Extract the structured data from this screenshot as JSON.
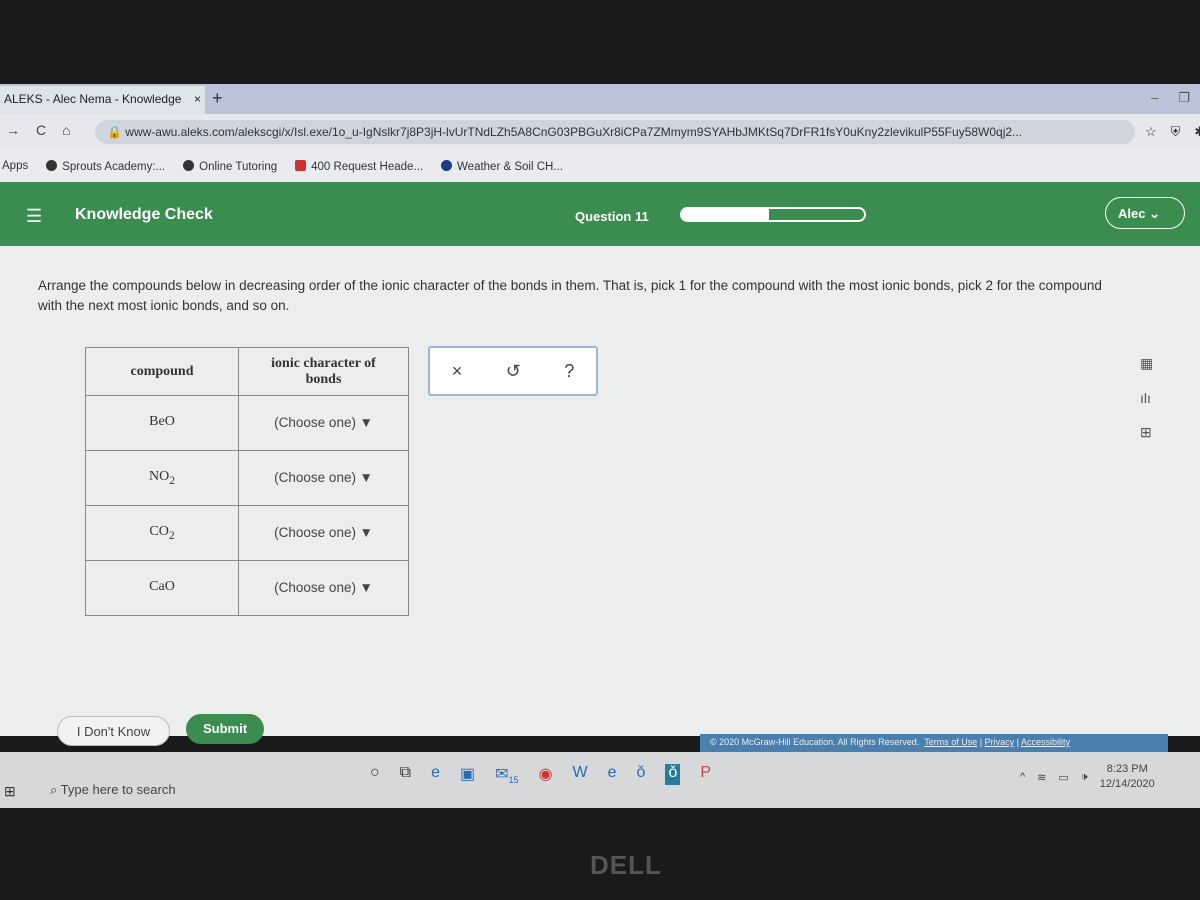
{
  "browser": {
    "tab_title": "ALEKS - Alec Nema - Knowledge",
    "tab_close": "×",
    "new_tab": "+",
    "url": "www-awu.aleks.com/alekscgi/x/Isl.exe/1o_u-IgNslkr7j8P3jH-lvUrTNdLZh5A8CnG03PBGuXr8iCPa7ZMmym9SYAHbJMKtSq7DrFR1fsY0uKny2zlevikulP55Fuy58W0qj2...",
    "bookmarks": [
      "Apps",
      "Sprouts Academy:...",
      "Online Tutoring",
      "400 Request Heade...",
      "Weather & Soil CH..."
    ]
  },
  "header": {
    "title": "Knowledge Check",
    "question": "Question 11",
    "progress": 0.48,
    "user": "Alec",
    "accent": "#3a8d4f"
  },
  "prompt": "Arrange the compounds below in decreasing order of the ionic character of the bonds in them. That is, pick 1 for the compound with the most ionic bonds, pick 2 for the compound with the next most ionic bonds, and so on.",
  "table": {
    "headers": [
      "compound",
      "ionic character of bonds"
    ],
    "rows": [
      {
        "compound": "BeO",
        "sub": "",
        "value": "(Choose one)"
      },
      {
        "compound": "NO",
        "sub": "2",
        "value": "(Choose one)"
      },
      {
        "compound": "CO",
        "sub": "2",
        "value": "(Choose one)"
      },
      {
        "compound": "CaO",
        "sub": "",
        "value": "(Choose one)"
      }
    ]
  },
  "tools": {
    "clear": "×",
    "undo": "↺",
    "help": "?"
  },
  "buttons": {
    "idk": "I Don't Know",
    "submit": "Submit"
  },
  "footer": {
    "copyright": "© 2020 McGraw-Hill Education. All Rights Reserved.",
    "terms": "Terms of Use",
    "privacy": "Privacy",
    "accessibility": "Accessibility"
  },
  "taskbar": {
    "search": "Type here to search",
    "time": "8:23 PM",
    "date": "12/14/2020",
    "badge": "15"
  },
  "bezel": {
    "brand": "DELL"
  }
}
